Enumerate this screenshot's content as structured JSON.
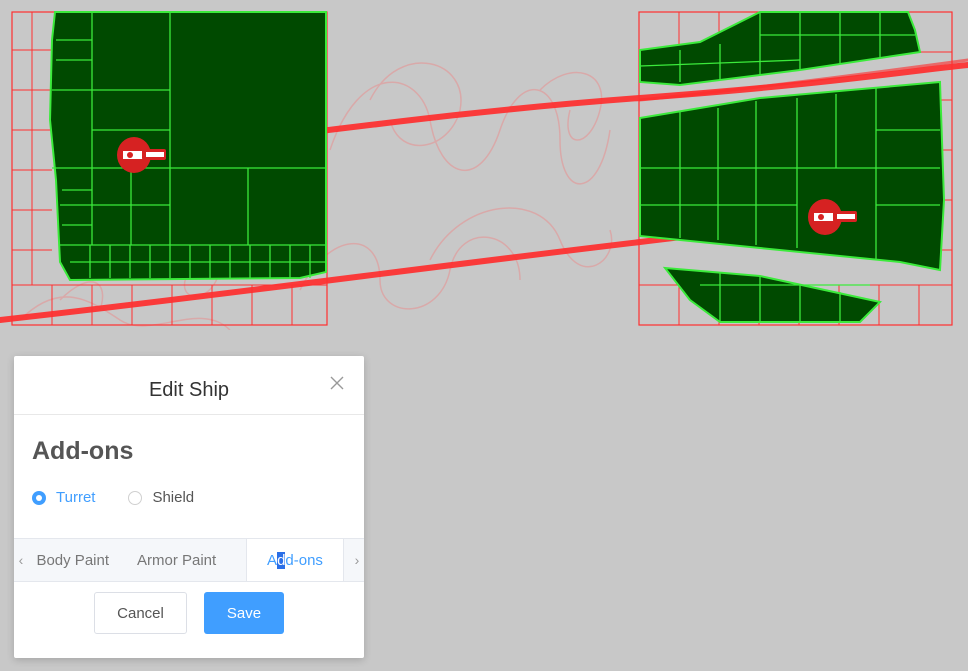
{
  "scene": {
    "ship_color": "#d62222",
    "hull_fill": "#004a00",
    "hull_grid": "#3bea3b",
    "damage_grid": "#ff3030",
    "trail_color": "#ff2a2a"
  },
  "modal": {
    "title": "Edit Ship",
    "close_icon": "close-icon",
    "section_title": "Add-ons",
    "options": [
      {
        "label": "Turret",
        "checked": true
      },
      {
        "label": "Shield",
        "checked": false
      }
    ],
    "tabs": {
      "body_paint": "Body Paint",
      "armor_paint": "Armor Paint",
      "addons_prefix": "A",
      "addons_cursor": "d",
      "addons_suffix": "d-ons",
      "prev_icon": "chevron-left-icon",
      "next_icon": "chevron-right-icon"
    },
    "buttons": {
      "cancel": "Cancel",
      "save": "Save"
    },
    "accent_color": "#409eff"
  }
}
